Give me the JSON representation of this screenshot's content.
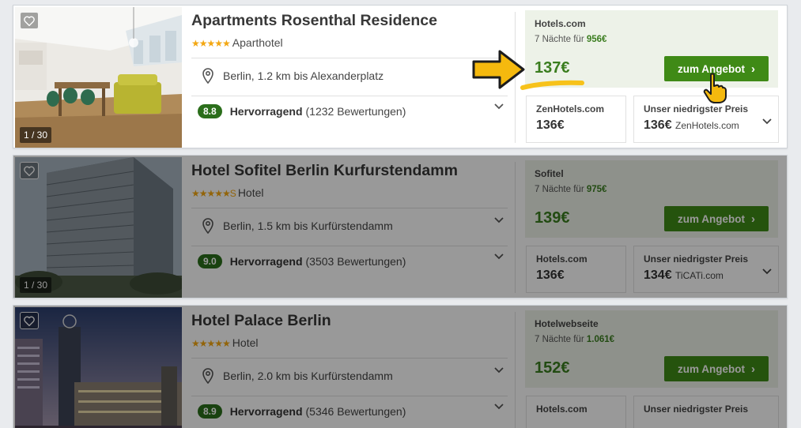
{
  "hotels": [
    {
      "name": "Apartments Rosenthal Residence",
      "type": "Aparthotel",
      "stars": "★★★★★",
      "photo_counter": "1 / 30",
      "location": "Berlin, 1.2 km bis Alexanderplatz",
      "rating_score": "8.8",
      "rating_label": "Hervorragend",
      "rating_count": "(1232 Bewertungen)",
      "deal_provider": "Hotels.com",
      "deal_nights": "7 Nächte für",
      "deal_total": "956€",
      "deal_price": "137€",
      "cta_label": "zum Angebot",
      "alt1_provider": "ZenHotels.com",
      "alt1_price": "136€",
      "alt2_label": "Unser niedrigster Preis",
      "alt2_price": "136€",
      "alt2_site": "ZenHotels.com"
    },
    {
      "name": "Hotel Sofitel Berlin Kurfurstendamm",
      "type": "Hotel",
      "stars": "★★★★★",
      "stars_suffix": "S",
      "photo_counter": "1 / 30",
      "location": "Berlin, 1.5 km bis Kurfürstendamm",
      "rating_score": "9.0",
      "rating_label": "Hervorragend",
      "rating_count": "(3503 Bewertungen)",
      "deal_provider": "Sofitel",
      "deal_nights": "7 Nächte für",
      "deal_total": "975€",
      "deal_price": "139€",
      "cta_label": "zum Angebot",
      "alt1_provider": "Hotels.com",
      "alt1_price": "136€",
      "alt2_label": "Unser niedrigster Preis",
      "alt2_price": "134€",
      "alt2_site": "TiCATi.com"
    },
    {
      "name": "Hotel Palace Berlin",
      "type": "Hotel",
      "stars": "★★★★★",
      "location": "Berlin, 2.0 km bis Kurfürstendamm",
      "rating_score": "8.9",
      "rating_label": "Hervorragend",
      "rating_count": "(5346 Bewertungen)",
      "deal_provider": "Hotelwebseite",
      "deal_nights": "7 Nächte für",
      "deal_total": "1.061€",
      "deal_price": "152€",
      "cta_label": "zum Angebot",
      "alt1_provider": "Hotels.com",
      "alt2_label": "Unser niedrigster Preis"
    }
  ],
  "colors": {
    "accent_green": "#3f8a16",
    "price_green": "#3a7d1e",
    "deal_bg": "#edf2e8",
    "arrow_yellow": "#f5b90e"
  },
  "icons": [
    "heart-icon",
    "location-pin-icon",
    "chevron-down-icon",
    "chevron-right-icon",
    "hand-pointer-icon",
    "arrow-right-icon"
  ]
}
